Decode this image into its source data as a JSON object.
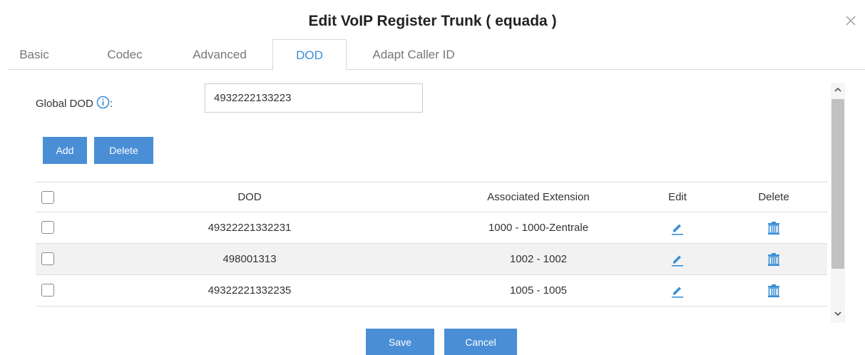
{
  "dialog": {
    "title": "Edit VoIP Register Trunk ( equada )"
  },
  "tabs": [
    {
      "label": "Basic",
      "active": false
    },
    {
      "label": "Codec",
      "active": false
    },
    {
      "label": "Advanced",
      "active": false
    },
    {
      "label": "DOD",
      "active": true
    },
    {
      "label": "Adapt Caller ID",
      "active": false
    }
  ],
  "global_dod": {
    "label": "Global DOD",
    "label_suffix": ":",
    "info_icon": "info-icon",
    "value": "4932222133223"
  },
  "toolbar": {
    "add_label": "Add",
    "delete_label": "Delete"
  },
  "table": {
    "columns": [
      "DOD",
      "Associated Extension",
      "Edit",
      "Delete"
    ],
    "rows": [
      {
        "dod": "49322221332231",
        "extension": "1000 - 1000-Zentrale"
      },
      {
        "dod": "498001313",
        "extension": "1002 - 1002"
      },
      {
        "dod": "49322221332235",
        "extension": "1005 - 1005"
      }
    ],
    "edit_icon": "pencil-icon",
    "delete_icon": "trash-icon"
  },
  "footer": {
    "save_label": "Save",
    "cancel_label": "Cancel"
  },
  "colors": {
    "accent": "#4a8ed6",
    "active_tab": "#3a8fd6",
    "row_shade": "#f2f2f2"
  }
}
